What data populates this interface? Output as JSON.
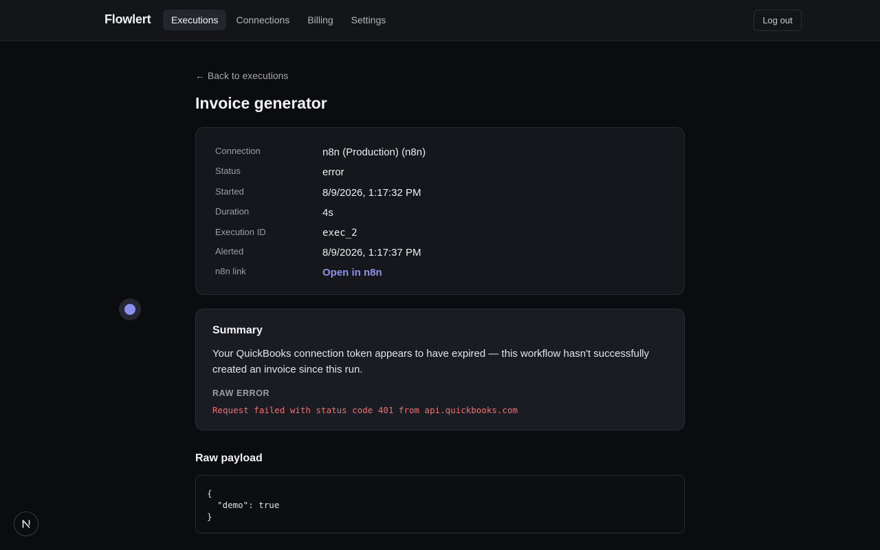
{
  "header": {
    "brand": "Flowlert",
    "nav": [
      {
        "label": "Executions",
        "active": true
      },
      {
        "label": "Connections",
        "active": false
      },
      {
        "label": "Billing",
        "active": false
      },
      {
        "label": "Settings",
        "active": false
      }
    ],
    "logout_label": "Log out"
  },
  "back_link": "← Back to executions",
  "page_title": "Invoice generator",
  "details": {
    "connection": {
      "label": "Connection",
      "value": "n8n (Production) (n8n)"
    },
    "status": {
      "label": "Status",
      "value": "error"
    },
    "started": {
      "label": "Started",
      "value": "8/9/2026, 1:17:32 PM"
    },
    "duration": {
      "label": "Duration",
      "value": "4s"
    },
    "execution_id": {
      "label": "Execution ID",
      "value": "exec_2"
    },
    "alerted": {
      "label": "Alerted",
      "value": "8/9/2026, 1:17:37 PM"
    },
    "n8n_link": {
      "label": "n8n link",
      "value": "Open in n8n"
    }
  },
  "summary": {
    "title": "Summary",
    "text": "Your QuickBooks connection token appears to have expired — this workflow hasn't successfully created an invoice since this run.",
    "raw_error_label": "RAW ERROR",
    "raw_error": "Request failed with status code 401 from api.quickbooks.com"
  },
  "payload": {
    "title": "Raw payload",
    "content": "{\n  \"demo\": true\n}"
  },
  "colors": {
    "accent": "#8f93e8",
    "error": "#f07070",
    "background": "#0b0c10"
  },
  "icons": {
    "cursor_indicator": "cursor-dot-icon",
    "dev_badge": "nextjs-logo-icon"
  }
}
